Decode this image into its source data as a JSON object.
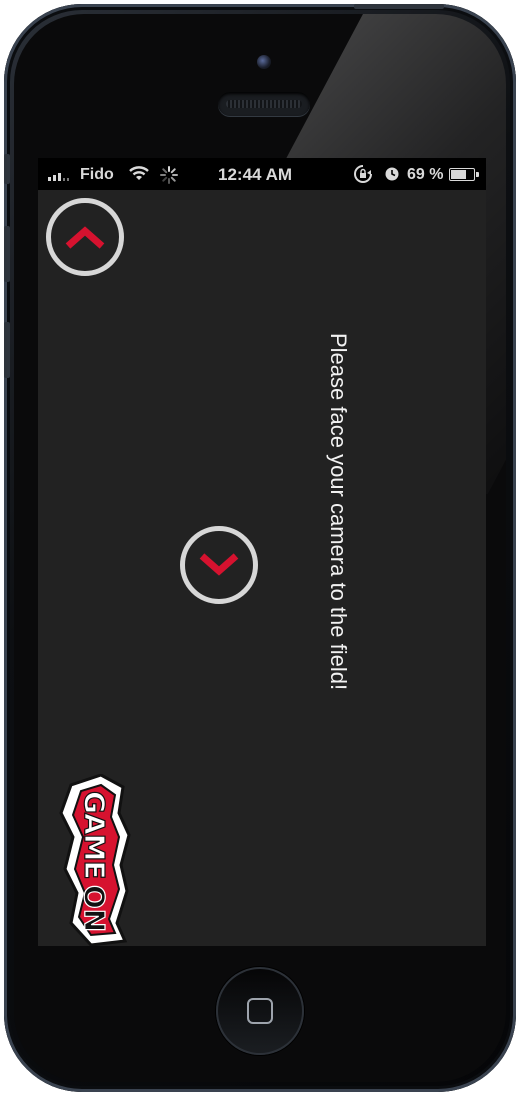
{
  "status_bar": {
    "carrier": "Fido",
    "time": "12:44 AM",
    "battery_percent": "69",
    "battery_suffix": "%",
    "battery_level": 0.69,
    "icons": [
      "signal-icon",
      "wifi-icon",
      "activity-spinner-icon",
      "rotation-lock-icon",
      "alarm-icon",
      "battery-icon"
    ]
  },
  "main": {
    "instruction_text": "Please face your camera to the field!",
    "up_button_icon": "chevron-up-icon",
    "down_button_icon": "chevron-down-icon"
  },
  "branding": {
    "logo_text": "GAME ON"
  },
  "colors": {
    "screen_background": "#222222",
    "chevron_red": "#d6122f",
    "circle_outline": "#d7d7d7",
    "text": "#f2f2f2"
  },
  "device": {
    "home_button_icon": "home-square-icon"
  }
}
